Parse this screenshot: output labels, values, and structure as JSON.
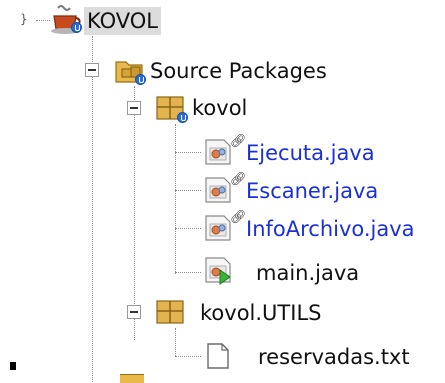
{
  "tree": {
    "project": {
      "label": "KOVOL",
      "icon": "coffee-cup-project-icon"
    },
    "source_packages": {
      "label": "Source Packages",
      "icon": "source-folder-icon"
    },
    "packages": [
      {
        "label": "kovol",
        "icon": "package-icon",
        "files": [
          {
            "label": "Ejecuta.java",
            "icon": "java-class-icon",
            "modified": true
          },
          {
            "label": "Escaner.java",
            "icon": "java-class-icon",
            "modified": true
          },
          {
            "label": "InfoArchivo.java",
            "icon": "java-class-icon",
            "modified": true
          },
          {
            "label": "main.java",
            "icon": "java-main-class-icon",
            "modified": false
          }
        ]
      },
      {
        "label": "kovol.UTILS",
        "icon": "package-icon",
        "files": [
          {
            "label": "reservadas.txt",
            "icon": "text-file-icon",
            "modified": false
          }
        ]
      }
    ]
  },
  "colors": {
    "modified_text": "#1a2fd6",
    "normal_text": "#111111",
    "selection": "#dcdcdc"
  }
}
